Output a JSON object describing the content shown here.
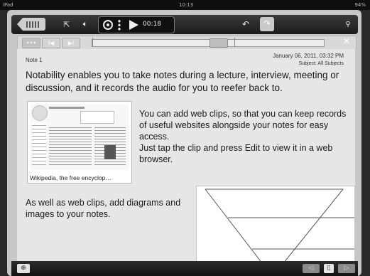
{
  "status_bar": {
    "device": "iPad",
    "time": "10:13",
    "battery": "94%"
  },
  "toolbar": {
    "notebooks_icon": "notebooks-icon",
    "share_icon": "share-icon",
    "audio_icon": "speaker-icon",
    "record_icon": "record-icon",
    "menu_icon": "dots-icon",
    "play_icon": "play-icon",
    "timer": "00:18",
    "undo_icon": "undo-icon",
    "redo_icon": "redo-icon",
    "search_icon": "search-icon"
  },
  "playback": {
    "more_label": "•••",
    "prev_label": "I◀",
    "next_label": "▶I",
    "close_label": "✕",
    "position": 0.55
  },
  "note": {
    "title": "Note 1",
    "date": "January 06, 2011, 03:32 PM",
    "subject": "Subject: All Subjects",
    "paragraph1": "Notability enables you to take notes during a lecture, interview, meeting or discussion, and it records the audio for you to reefer back to.",
    "web_clip": {
      "caption": "Wikipedia, the free encyclop…"
    },
    "paragraph2": "You can add web clips, so that you can keep records of useful websites alongside your notes for easy access.",
    "paragraph2b": "Just tap the clip and press Edit to view it in a web browser.",
    "paragraph3": "As well as web clips, add diagrams and images to your notes."
  },
  "bottom_bar": {
    "add_icon": "add-page-icon",
    "prev_page_icon": "prev-page-icon",
    "page_icon": "page-icon",
    "next_page_icon": "next-page-icon"
  },
  "colors": {
    "toolbar": "#1e1e1e",
    "page": "#e6e6e6",
    "frame": "#c7c7c7"
  }
}
